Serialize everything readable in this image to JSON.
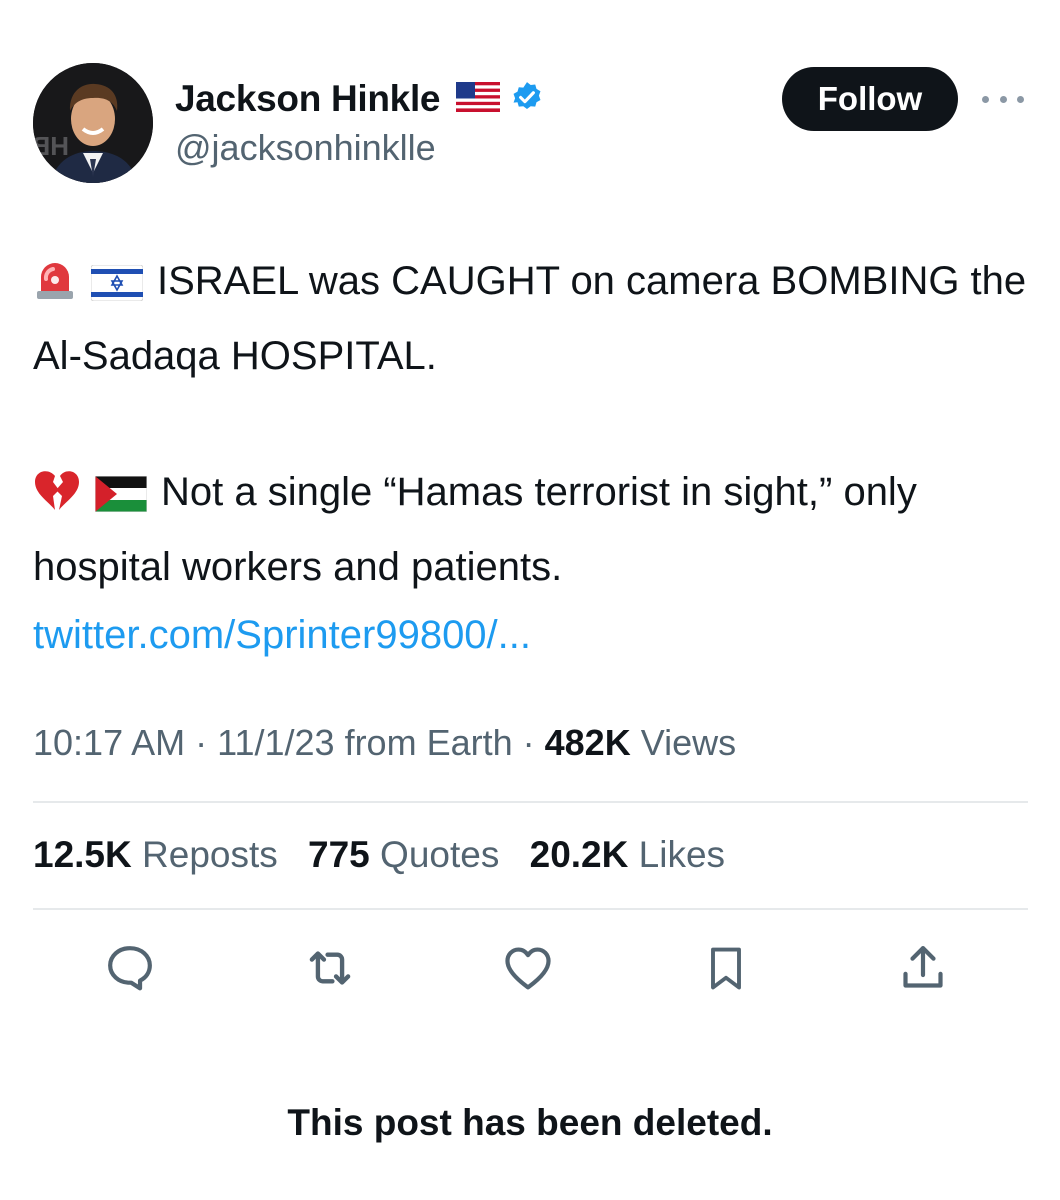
{
  "author": {
    "display_name": "Jackson Hinkle",
    "handle": "@jacksonhinklle",
    "flag_icon": "us-flag-icon",
    "verified_icon": "verified-badge-icon",
    "verified_color": "#1d9bf0"
  },
  "follow_button": {
    "label": "Follow"
  },
  "tweet": {
    "line1_text": "ISRAEL was CAUGHT on camera BOMBING the Al-Sadaqa HOSPITAL.",
    "line2_text": "Not a single “Hamas terrorist in sight,” only hospital workers and patients.",
    "link_text": "twitter.com/Sprinter99800/...",
    "emojis_line1": [
      "siren-icon",
      "israel-flag-icon"
    ],
    "emojis_line2": [
      "broken-heart-icon",
      "palestine-flag-icon"
    ]
  },
  "meta": {
    "time": "10:17 AM",
    "date_source": "11/1/23 from Earth",
    "views_count": "482K",
    "views_label": "Views"
  },
  "stats": {
    "reposts_count": "12.5K",
    "reposts_label": "Reposts",
    "quotes_count": "775",
    "quotes_label": "Quotes",
    "likes_count": "20.2K",
    "likes_label": "Likes"
  },
  "actions": [
    "reply-icon",
    "repost-icon",
    "like-icon",
    "bookmark-icon",
    "share-icon"
  ],
  "footer": {
    "deleted_notice": "This post has been deleted."
  },
  "colors": {
    "link": "#1d9bf0",
    "secondary_text": "#536471",
    "primary_text": "#0f1419"
  }
}
